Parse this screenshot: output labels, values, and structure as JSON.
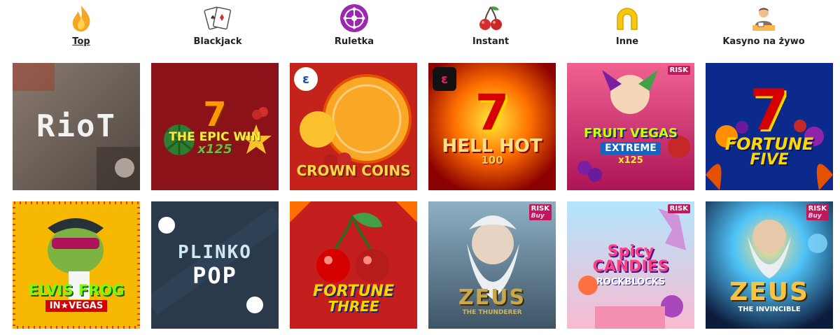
{
  "nav": {
    "items": [
      {
        "label": "Top",
        "icon": "fire-icon",
        "active": true
      },
      {
        "label": "Blackjack",
        "icon": "playing-cards-icon",
        "active": false
      },
      {
        "label": "Ruletka",
        "icon": "roulette-icon",
        "active": false
      },
      {
        "label": "Instant",
        "icon": "cherries-icon",
        "active": false
      },
      {
        "label": "Inne",
        "icon": "horseshoe-icon",
        "active": false
      },
      {
        "label": "Kasyno na żywo",
        "icon": "live-dealer-icon",
        "active": false
      }
    ]
  },
  "games": [
    {
      "name": "riot",
      "title": "RioT",
      "subtitle": "",
      "extra": "",
      "badge": "",
      "badge2": "",
      "theme": "riot"
    },
    {
      "name": "the-epic-win",
      "title": "THE EPIC WIN",
      "subtitle": "x125",
      "extra": "7",
      "badge": "",
      "badge2": "",
      "theme": "epic"
    },
    {
      "name": "crown-coins",
      "title": "CROWN COINS",
      "subtitle": "",
      "extra": "",
      "badge": "",
      "badge2": "",
      "theme": "crown"
    },
    {
      "name": "hell-hot-100",
      "title": "HELL HOT",
      "subtitle": "100",
      "extra": "7",
      "badge": "",
      "badge2": "",
      "theme": "hell"
    },
    {
      "name": "fruit-vegas-extreme",
      "title": "FRUIT VEGAS",
      "subtitle": "EXTREME",
      "extra": "x125",
      "badge": "RISK",
      "badge2": "",
      "theme": "fruitvegas"
    },
    {
      "name": "fortune-five",
      "title": "FORTUNE",
      "subtitle": "FIVE",
      "extra": "7",
      "badge": "",
      "badge2": "",
      "theme": "fortunefive"
    },
    {
      "name": "elvis-frog-in-vegas",
      "title": "ELVIS FROG",
      "subtitle": "IN★VEGAS",
      "extra": "",
      "badge": "",
      "badge2": "",
      "theme": "elvis"
    },
    {
      "name": "plinko-pop",
      "title": "PLINKO",
      "subtitle": "POP",
      "extra": "",
      "badge": "",
      "badge2": "",
      "theme": "plinko"
    },
    {
      "name": "fortune-three",
      "title": "FORTUNE",
      "subtitle": "THREE",
      "extra": "",
      "badge": "",
      "badge2": "",
      "theme": "fortunethree"
    },
    {
      "name": "zeus-the-thunderer",
      "title": "ZEUS",
      "subtitle": "THE THUNDERER",
      "extra": "",
      "badge": "RISK",
      "badge2": "Buy",
      "theme": "zeus1"
    },
    {
      "name": "spicy-candies-rockblocks",
      "title": "Spicy CANDIES",
      "subtitle": "ROCKBLOCKS",
      "extra": "",
      "badge": "RISK",
      "badge2": "",
      "theme": "spicy"
    },
    {
      "name": "zeus-the-invincible",
      "title": "ZEUS",
      "subtitle": "THE INVINCIBLE",
      "extra": "",
      "badge": "RISK",
      "badge2": "Buy",
      "theme": "zeus2"
    }
  ]
}
